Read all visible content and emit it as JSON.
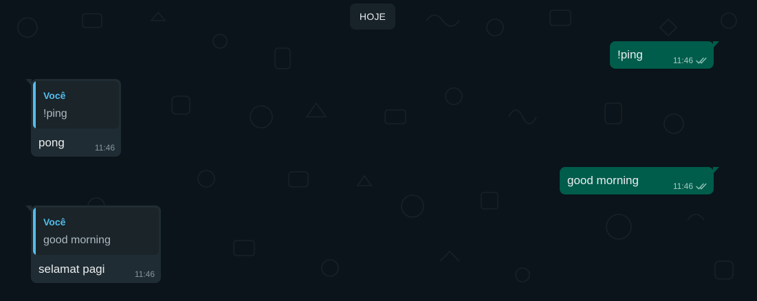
{
  "chat": {
    "date_divider": "HOJE",
    "messages": [
      {
        "direction": "outgoing",
        "text": "!ping",
        "time": "11:46",
        "status": "read",
        "status_icon": "double-check-icon"
      },
      {
        "direction": "incoming",
        "quote": {
          "author": "Você",
          "text": "!ping"
        },
        "text": "pong",
        "time": "11:46"
      },
      {
        "direction": "outgoing",
        "text": "good morning",
        "time": "11:46",
        "status": "read",
        "status_icon": "double-check-icon"
      },
      {
        "direction": "incoming",
        "quote": {
          "author": "Você",
          "text": "good morning"
        },
        "text": "selamat pagi",
        "time": "11:46"
      }
    ]
  },
  "colors": {
    "background": "#0b141a",
    "outgoing_bubble": "#005c4b",
    "incoming_bubble": "#202c33",
    "quote_accent": "#53bdeb",
    "date_pill": "#182229"
  }
}
